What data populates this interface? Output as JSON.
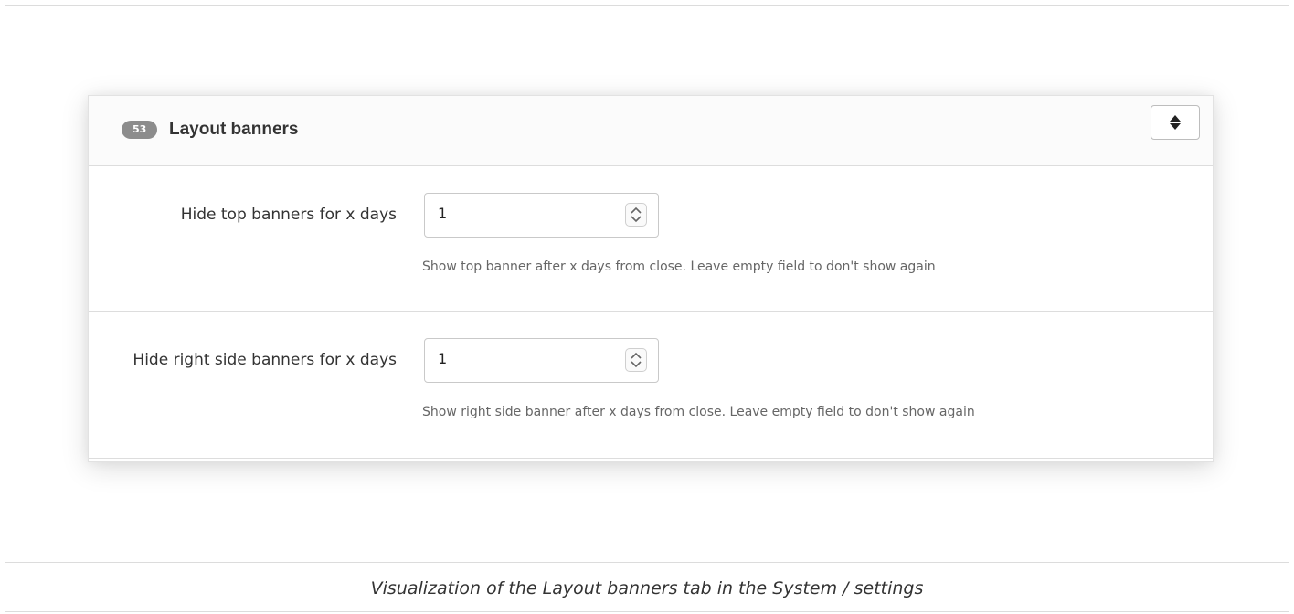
{
  "panel": {
    "badge": "53",
    "title": "Layout banners",
    "toggle_icon": "sort-updown-icon"
  },
  "fields": [
    {
      "label": "Hide top banners for x days",
      "value": "1",
      "help": "Show top banner after x days from close. Leave empty field to don't show again"
    },
    {
      "label": "Hide right side banners for x days",
      "value": "1",
      "help": "Show right side banner after x days from close. Leave empty field to don't show again"
    }
  ],
  "caption": "Visualization of the Layout banners tab in the System / settings",
  "colors": {
    "badge_bg": "#8c8c8c",
    "text": "#333333",
    "help_text": "#666666",
    "border": "#dddddd"
  }
}
